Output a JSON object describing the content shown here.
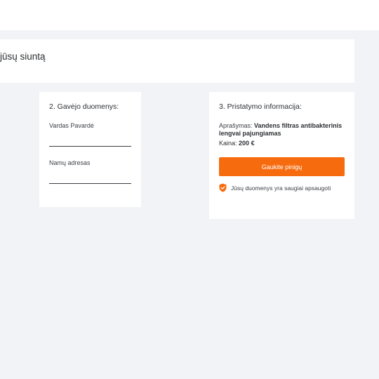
{
  "header": {
    "title": "jūsų siuntą"
  },
  "recipient": {
    "heading": "2. Gavėjo duomenys:",
    "name_label": "Vardas Pavardė",
    "name_value": "",
    "address_label": "Namų adresas",
    "address_value": ""
  },
  "delivery": {
    "heading": "3. Pristatymo informacija:",
    "description_label": "Aprašymas:",
    "description_value": "Vandens filtras antibakterinis lengvai pajungiamas",
    "price_label": "Kaina:",
    "price_value": "200 €",
    "button_label": "Gaukite pinigų",
    "secure_text": "Jūsų duomenys yra saugiai apsaugoti",
    "secure_icon": "shield-icon"
  },
  "colors": {
    "accent": "#f76b0f",
    "background": "#f1f3f6",
    "card": "#ffffff"
  }
}
